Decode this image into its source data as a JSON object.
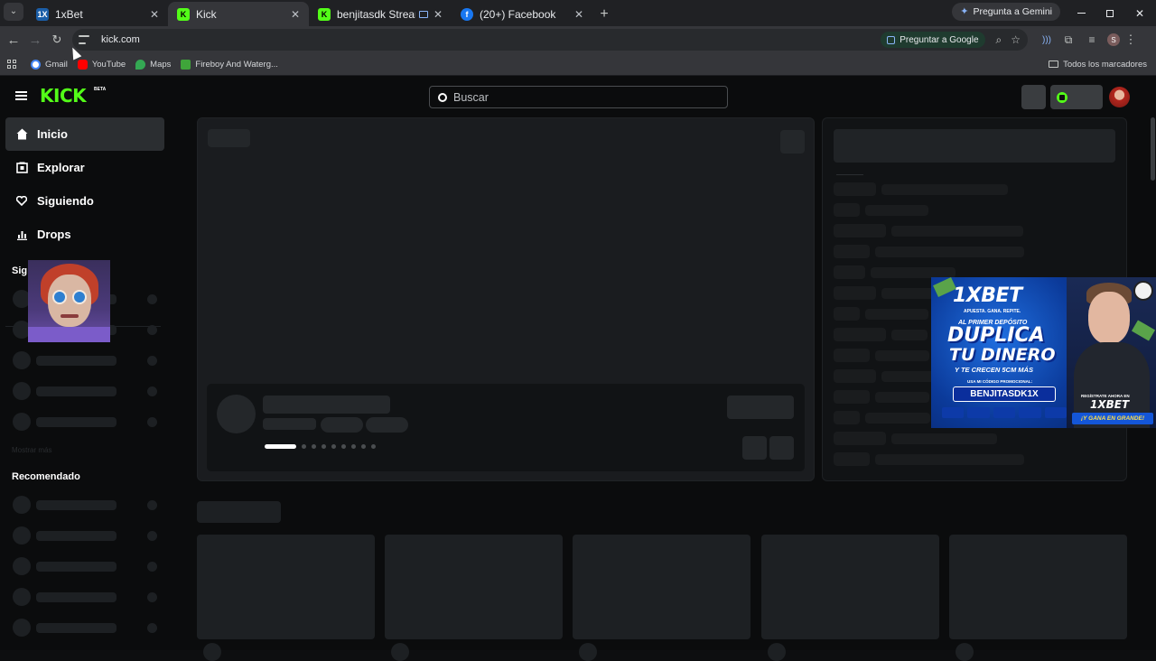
{
  "browser": {
    "tabs": [
      {
        "title": "1xBet",
        "favicon": "1xbet-icon",
        "active": false
      },
      {
        "title": "Kick",
        "favicon": "kick-icon",
        "active": true
      },
      {
        "title": "benjitasdk Stream - Watch",
        "favicon": "kick-icon",
        "active": false
      },
      {
        "title": "(20+) Facebook",
        "favicon": "facebook-icon",
        "active": false
      }
    ],
    "gemini_button": "Pregunta a Gemini",
    "url": "kick.com",
    "ask_google": "Preguntar a Google",
    "profile_initial": "S",
    "bookmarks": [
      {
        "label": "Gmail",
        "icon": "google-icon"
      },
      {
        "label": "YouTube",
        "icon": "youtube-icon"
      },
      {
        "label": "Maps",
        "icon": "maps-icon"
      },
      {
        "label": "Fireboy And Waterg...",
        "icon": "game-icon"
      }
    ],
    "all_bookmarks": "Todos los marcadores"
  },
  "kick": {
    "logo": "KICK",
    "logo_badge": "BETA",
    "search_placeholder": "Buscar",
    "nav": [
      {
        "label": "Inicio",
        "icon": "home-icon",
        "active": true
      },
      {
        "label": "Explorar",
        "icon": "explore-icon",
        "active": false
      },
      {
        "label": "Siguiendo",
        "icon": "heart-icon",
        "active": false
      },
      {
        "label": "Drops",
        "icon": "drops-icon",
        "active": false
      }
    ],
    "following_heading": "Siguiendo",
    "following_heading_visible": "Sig",
    "show_more": "Mostrar más",
    "recommended_heading": "Recomendado"
  },
  "ad": {
    "brand": "1XBET",
    "tagline": "APUESTA. GANA. REPITE.",
    "line1": "AL PRIMER DEPÓSITO",
    "line2": "DUPLICA",
    "line3": "TU DINERO",
    "line4": "Y TE CRECEN 5CM MÁS",
    "promo_label": "USA MI CÓDIGO PROMOCIONAL:",
    "promo_code": "BENJITASDK1X",
    "register": "REGÍSTRATE AHORA EN",
    "cta": "¡Y GANA EN GRANDE!"
  },
  "colors": {
    "kick_green": "#53fc18",
    "chrome_dark": "#202124",
    "chrome_toolbar": "#35363a",
    "page_bg": "#0b0c0d"
  }
}
